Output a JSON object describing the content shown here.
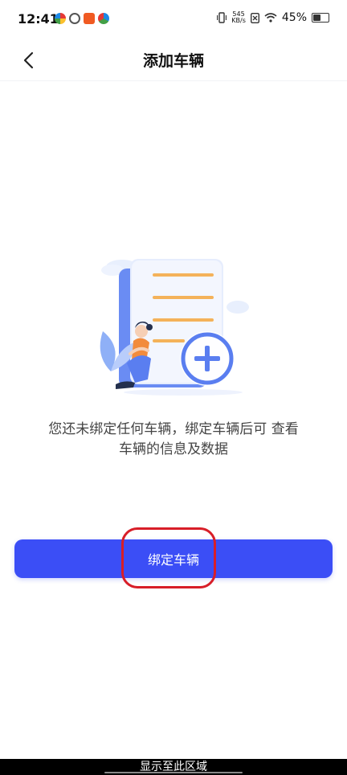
{
  "status_bar": {
    "time": "12:41",
    "net_speed_value": "545",
    "net_speed_unit": "KB/s",
    "battery_text": "45%",
    "battery_level": 0.45,
    "icons": [
      "vibrate-icon",
      "net-speed-indicator",
      "sim-blocked-icon",
      "wifi-icon",
      "battery-icon"
    ]
  },
  "header": {
    "title": "添加车辆"
  },
  "empty_state": {
    "message_line1": "您还未绑定任何车辆，绑定车辆后可 查看",
    "message_line2": "车辆的信息及数据"
  },
  "actions": {
    "bind_vehicle_label": "绑定车辆"
  },
  "system": {
    "bottom_hint": "显示至此区域"
  },
  "colors": {
    "accent": "#3b4ef6",
    "highlight": "#d81e28"
  }
}
